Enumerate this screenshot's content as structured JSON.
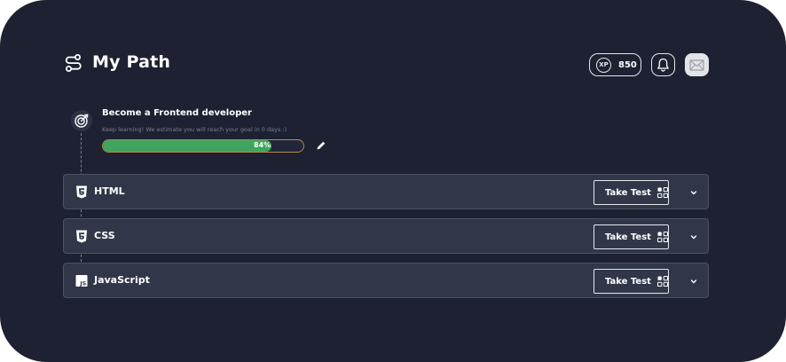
{
  "header": {
    "title": "My Path",
    "path_icon": "route-icon",
    "xp": {
      "badge": "XP",
      "value": "850"
    },
    "bell_icon": "bell-icon",
    "mail_icon": "mail-icon"
  },
  "goal": {
    "icon": "target-icon",
    "title": "Become a Frontend developer",
    "subtitle": "Keep learning! We estimate you will reach your goal in 0 days :)",
    "progress_percent": 84,
    "progress_label": "84%",
    "edit_icon": "pencil-icon"
  },
  "courses": [
    {
      "name": "HTML",
      "icon": "html5-icon",
      "action": "Take Test",
      "action_icon": "grid-icon",
      "expand_icon": "chevron-down-icon"
    },
    {
      "name": "CSS",
      "icon": "css3-icon",
      "action": "Take Test",
      "action_icon": "grid-icon",
      "expand_icon": "chevron-down-icon"
    },
    {
      "name": "JavaScript",
      "icon": "js-icon",
      "action": "Take Test",
      "action_icon": "grid-icon",
      "expand_icon": "chevron-down-icon"
    }
  ],
  "colors": {
    "background": "#1d2131",
    "card": "#313749",
    "progress_fill": "#3fa55e",
    "progress_border": "#b9864e"
  }
}
